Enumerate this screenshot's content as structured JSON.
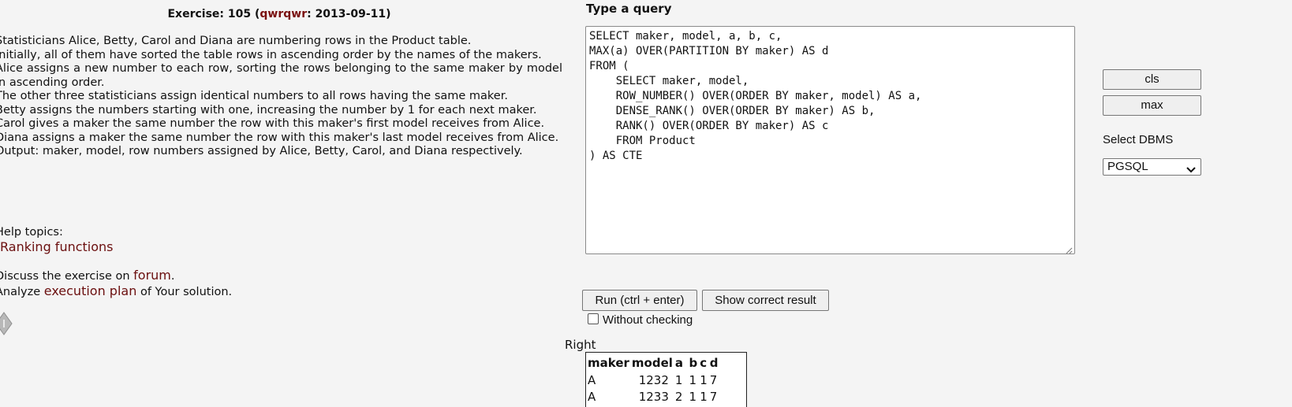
{
  "exercise": {
    "prefix": "Exercise: 105 (",
    "author": "qwrqwr",
    "date_suffix": ": 2013-09-11)"
  },
  "description": [
    "Statisticians Alice, Betty, Carol and Diana are numbering rows in the Product table.",
    "Initially, all of them have sorted the table rows in ascending order by the names of the makers.",
    "Alice assigns a new number to each row, sorting the rows belonging to the same maker by model in ascending order.",
    "The other three statisticians assign identical numbers to all rows having the same maker.",
    "Betty assigns the numbers starting with one, increasing the number by 1 for each next maker.",
    "Carol gives a maker the same number the row with this maker's first model receives from Alice.",
    "Diana assigns a maker the same number the row with this maker's last model receives from Alice.",
    "Output: maker, model, row numbers assigned by Alice, Betty, Carol, and Diana respectively."
  ],
  "help": {
    "label": "Help topics:",
    "link": "Ranking functions"
  },
  "discuss": {
    "before": "Discuss the exercise on ",
    "link": "forum",
    "after": "."
  },
  "analyze": {
    "before": "Analyze ",
    "link": "execution plan",
    "after": " of Your solution."
  },
  "icons": {
    "hint": "diamond-hint-icon",
    "chevron": "chevron-down-icon",
    "grip": "resize-grip-icon"
  },
  "query_panel": {
    "title": "Type a query",
    "text": "SELECT maker, model, a, b, c,\nMAX(a) OVER(PARTITION BY maker) AS d\nFROM (\n    SELECT maker, model,\n    ROW_NUMBER() OVER(ORDER BY maker, model) AS a,\n    DENSE_RANK() OVER(ORDER BY maker) AS b,\n    RANK() OVER(ORDER BY maker) AS c\n    FROM Product\n) AS CTE"
  },
  "toolbar": {
    "cls_label": "cls",
    "max_label": "max",
    "dbms_label": "Select DBMS",
    "dbms_value": "PGSQL"
  },
  "actions": {
    "run_label": "Run (ctrl + enter)",
    "show_label": "Show correct result",
    "without_checking": "Without checking"
  },
  "result": {
    "status": "Right",
    "columns": [
      "maker",
      "model",
      "a",
      "b",
      "c",
      "d"
    ],
    "rows": [
      [
        "A",
        "1232",
        "1",
        "1",
        "1",
        "7"
      ],
      [
        "A",
        "1233",
        "2",
        "1",
        "1",
        "7"
      ]
    ]
  },
  "colors": {
    "link": "#6b0f0f",
    "background": "#f4f4f4"
  }
}
